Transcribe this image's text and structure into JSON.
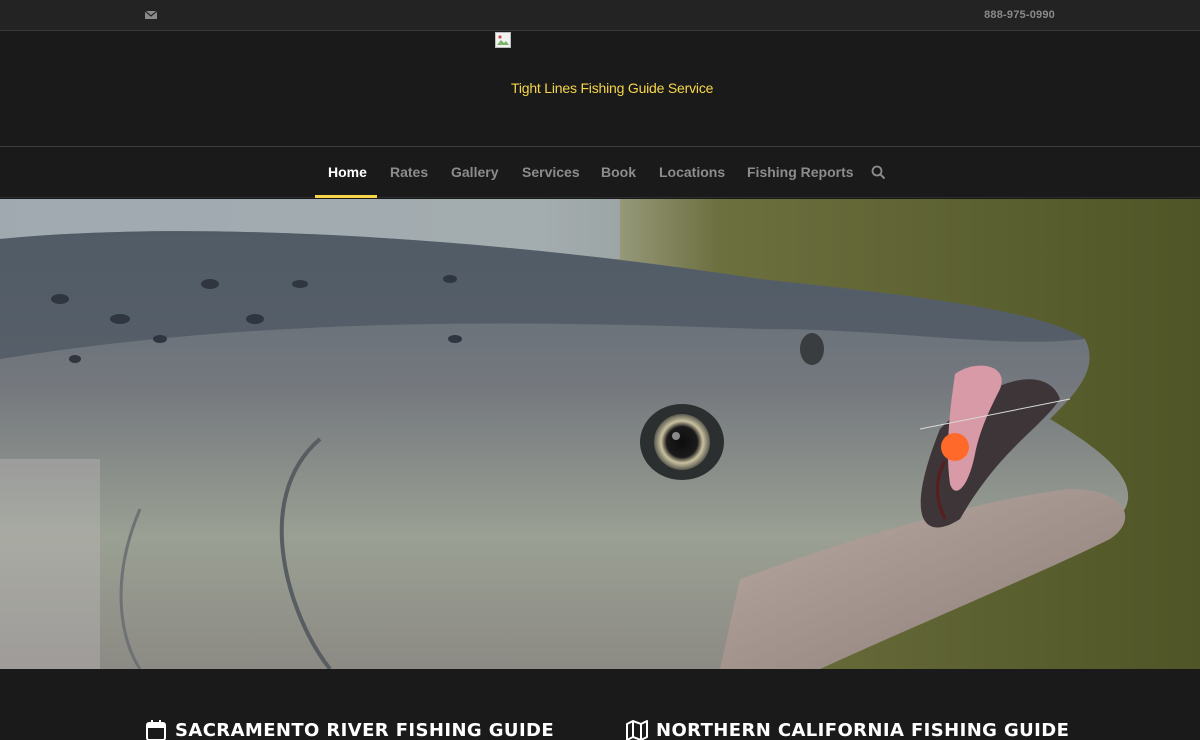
{
  "topbar": {
    "mail_icon": "envelope-icon",
    "phone": "888-975-0990"
  },
  "header": {
    "logo_icon": "broken-image-icon",
    "site_title": "Tight Lines Fishing Guide Service"
  },
  "nav": {
    "items": [
      {
        "label": "Home",
        "active": true
      },
      {
        "label": "Rates"
      },
      {
        "label": "Gallery"
      },
      {
        "label": "Services"
      },
      {
        "label": "Book"
      },
      {
        "label": "Locations"
      },
      {
        "label": "Fishing Reports"
      }
    ],
    "search_icon": "search-icon",
    "accent_color": "#f6d64a"
  },
  "hero": {
    "image": "salmon-head-photo"
  },
  "sections": {
    "left": {
      "icon": "calendar-icon",
      "title": "SACRAMENTO RIVER FISHING GUIDE"
    },
    "right": {
      "icon": "map-icon",
      "title": "NORTHERN CALIFORNIA FISHING GUIDE"
    }
  }
}
